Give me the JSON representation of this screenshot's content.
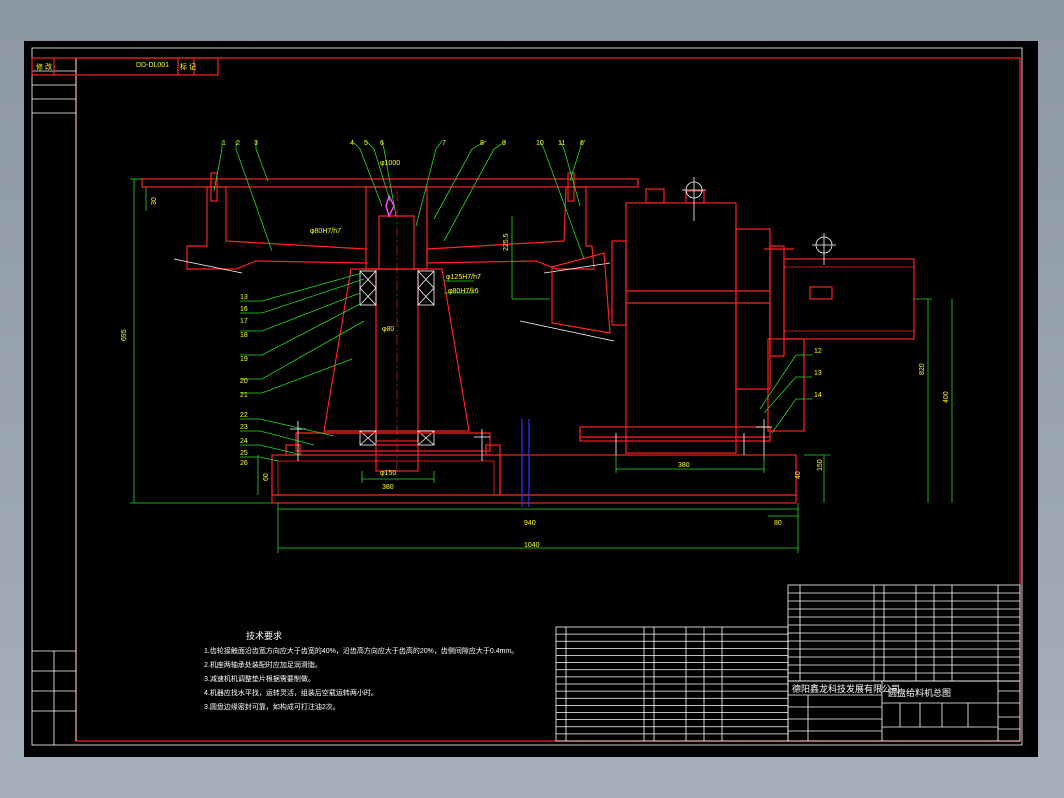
{
  "title_block": {
    "company": "德阳鑫龙科技发展有限公司",
    "drawing_title": "圆盘给料机总图",
    "top_left_code": "DD-DL001",
    "top_left_label_1": "修 改",
    "top_left_label_2": "标 记"
  },
  "tech_requirements": {
    "heading": "技术要求",
    "lines": [
      "1.齿轮接触面沿齿宽方向应大于齿宽的40%，沿齿高方向应大于齿高的20%，齿侧间隙应大于0.4mm。",
      "2.机座两轴承处装配时应加足润滑脂。",
      "3.减速机机调整垫片根据需要制做。",
      "4.机器应找水平找，运转灵活，组装后空载运转两小时。",
      "3.圆盘边缘密封可靠，如构成可打注油2次。"
    ]
  },
  "part_numbers_top": [
    "1",
    "2",
    "3",
    "4",
    "5",
    "6",
    "7",
    "8",
    "9",
    "10",
    "11",
    "8'"
  ],
  "part_numbers_left": [
    "13",
    "16",
    "17",
    "18",
    "19",
    "20",
    "21",
    "22",
    "23",
    "24",
    "25",
    "26"
  ],
  "part_numbers_right": [
    "12",
    "13",
    "14"
  ],
  "dimensions": {
    "top_dia": "φ1000",
    "fit_1": "φ80H7/h7",
    "fit_2": "φ125H7/h7",
    "fit_3": "φ80H7/k6",
    "shaft": "φ80",
    "bottom_dia": "φ150",
    "height_left": "695",
    "d_30": "30",
    "d_225": "225.5",
    "base_380": "380",
    "motor_380": "380",
    "d_820": "820",
    "d_400": "400",
    "d_150": "150",
    "d_40": "40",
    "d_60": "60",
    "d_940": "940",
    "d_80": "80",
    "d_1040": "1040"
  },
  "colors": {
    "background": "#000000",
    "red": "#ff2020",
    "yellow": "#ffff00",
    "white": "#ffffff",
    "green": "#22dd22",
    "cyan": "#22e0e0",
    "blue": "#3333ff"
  }
}
